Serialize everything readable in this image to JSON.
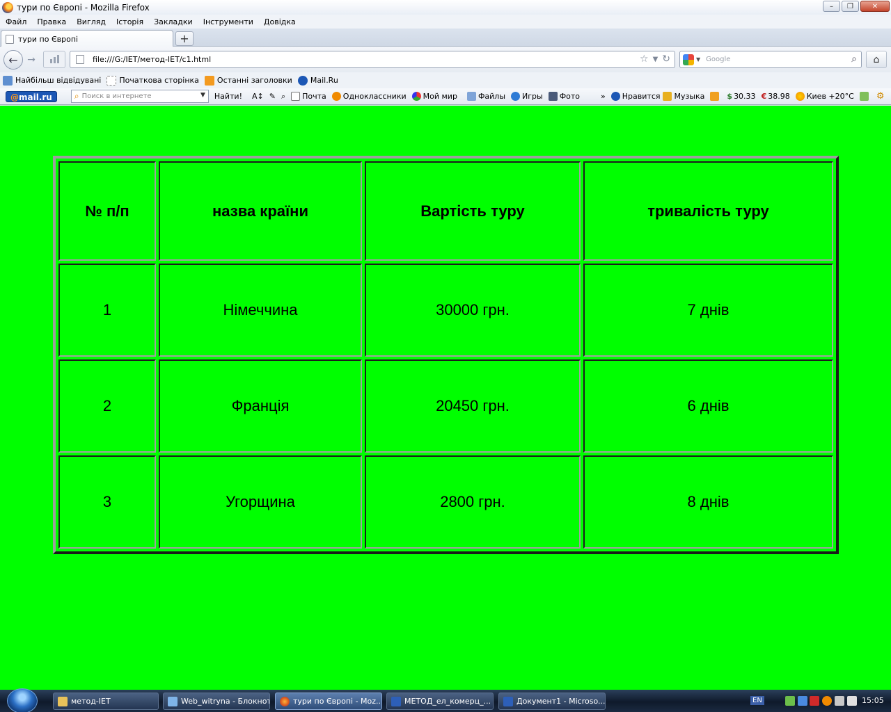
{
  "window": {
    "title": "тури по Європі - Mozilla Firefox"
  },
  "menu": [
    "Файл",
    "Правка",
    "Вигляд",
    "Історія",
    "Закладки",
    "Інструменти",
    "Довідка"
  ],
  "tab": {
    "label": "тури по Європі",
    "new_tab": "+"
  },
  "nav": {
    "url": "file:///G:/IET/метод-IET/c1.html",
    "search_placeholder": "Google"
  },
  "bookmarks": [
    "Найбільш відвідувані",
    "Початкова сторінка",
    "Останні заголовки",
    "Mail.Ru"
  ],
  "mailru": {
    "logo_prefix": "@",
    "logo_text": "mail.ru",
    "search_placeholder": "Поиск в интернете",
    "find_label": "Найти!",
    "items": [
      "Почта",
      "Одноклассники",
      "Мой мир",
      "Файлы",
      "Игры",
      "Фото"
    ],
    "more": "»",
    "items_right": [
      "Нравится",
      "Музыка"
    ],
    "usd": "30.33",
    "eur": "38.98",
    "weather": "Киев +20°C"
  },
  "table": {
    "headers": [
      "№ п/п",
      "назва країни",
      "Вартість туру",
      "тривалість туру"
    ],
    "rows": [
      [
        "1",
        "Німеччина",
        "30000 грн.",
        "7 днів"
      ],
      [
        "2",
        "Франція",
        "20450 грн.",
        "6 днів"
      ],
      [
        "3",
        "Угорщина",
        "2800 грн.",
        "8 днів"
      ]
    ]
  },
  "taskbar": {
    "tasks": [
      "метод-IET",
      "Web_witryna - Блокнот",
      "тури по Європі - Moz...",
      "МЕТОД_ел_комерц_...",
      "Документ1 - Microso..."
    ],
    "lang": "EN",
    "clock": "15:05"
  },
  "colors": {
    "page_background": "#00ff00"
  }
}
